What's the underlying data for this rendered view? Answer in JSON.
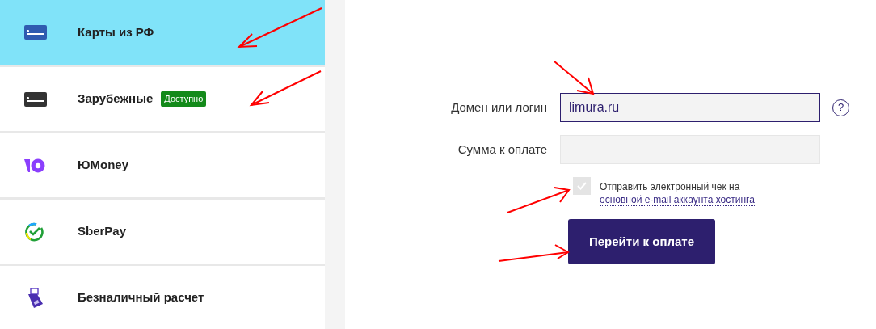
{
  "payment_methods": [
    {
      "kind": "card",
      "label": "Карты из РФ",
      "selected": true
    },
    {
      "kind": "card",
      "label": "Зарубежные",
      "badge": "Доступно",
      "selected": false
    },
    {
      "kind": "yoomoney",
      "label": "ЮMoney",
      "selected": false
    },
    {
      "kind": "sberpay",
      "label": "SberPay",
      "selected": false
    },
    {
      "kind": "terminal",
      "label": "Безналичный расчет",
      "selected": false
    }
  ],
  "form": {
    "fields": [
      {
        "label": "Домен или логин",
        "value": "limura.ru",
        "focused": true,
        "help": "?"
      },
      {
        "label": "Сумма к оплате",
        "focused": false
      }
    ],
    "receipt": {
      "checked": true,
      "text": "Отправить электронный чек на",
      "link": "основной e-mail аккаунта хостинга"
    },
    "submit": "Перейти к оплате"
  }
}
